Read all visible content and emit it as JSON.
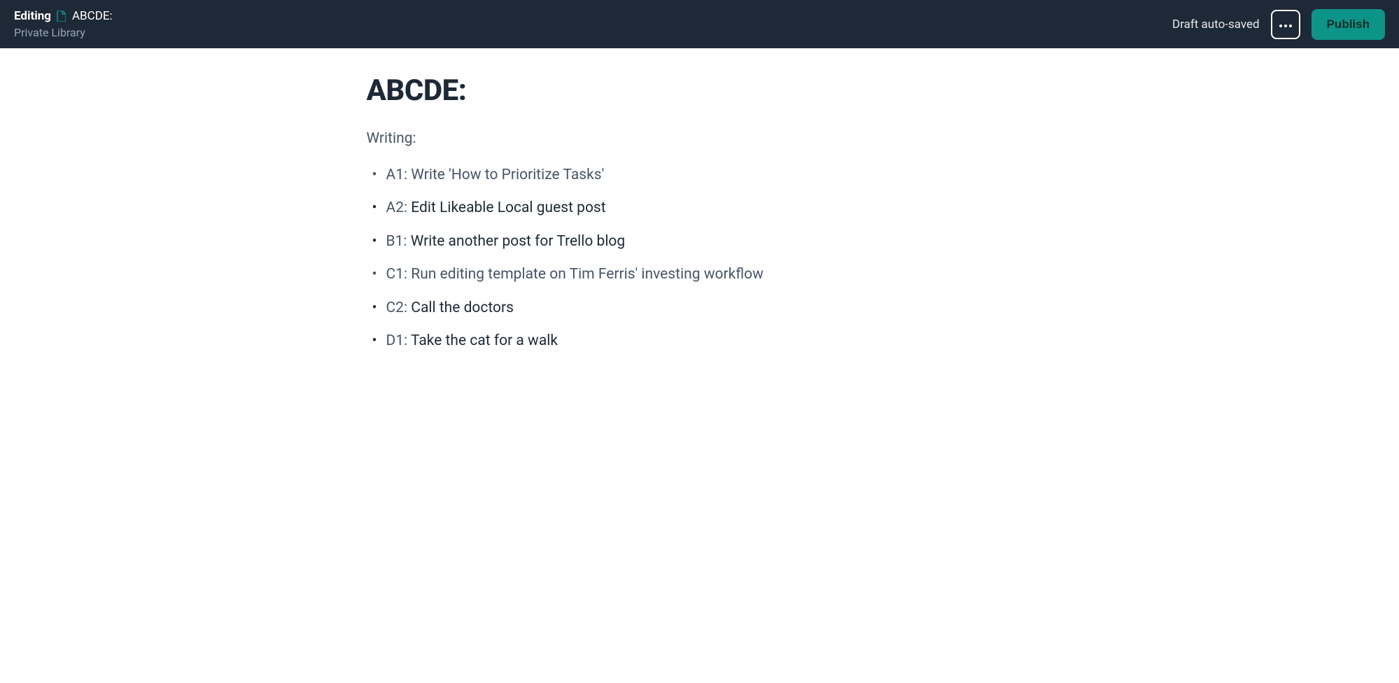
{
  "header": {
    "editing_label": "Editing",
    "doc_title": "ABCDE:",
    "library_label": "Private Library",
    "autosave_text": "Draft auto-saved",
    "publish_label": "Publish"
  },
  "colors": {
    "header_bg": "#1e2937",
    "accent": "#0d9488",
    "muted_text": "#475569"
  },
  "content": {
    "title": "ABCDE:",
    "section_label": "Writing:",
    "tasks": [
      {
        "prefix": "A1:",
        "text": " Write 'How to Prioritize Tasks'",
        "muted": true
      },
      {
        "prefix": "A2:",
        "text": " Edit Likeable Local guest post",
        "muted": false
      },
      {
        "prefix": "B1:",
        "text": " Write another post for Trello blog",
        "muted": false
      },
      {
        "prefix": "C1:",
        "text": " Run editing template on Tim Ferris' investing workflow",
        "muted": true
      },
      {
        "prefix": "C2:",
        "text": " Call the doctors",
        "muted": false
      },
      {
        "prefix": "D1:",
        "text": " Take the cat for a walk",
        "muted": false
      }
    ]
  }
}
